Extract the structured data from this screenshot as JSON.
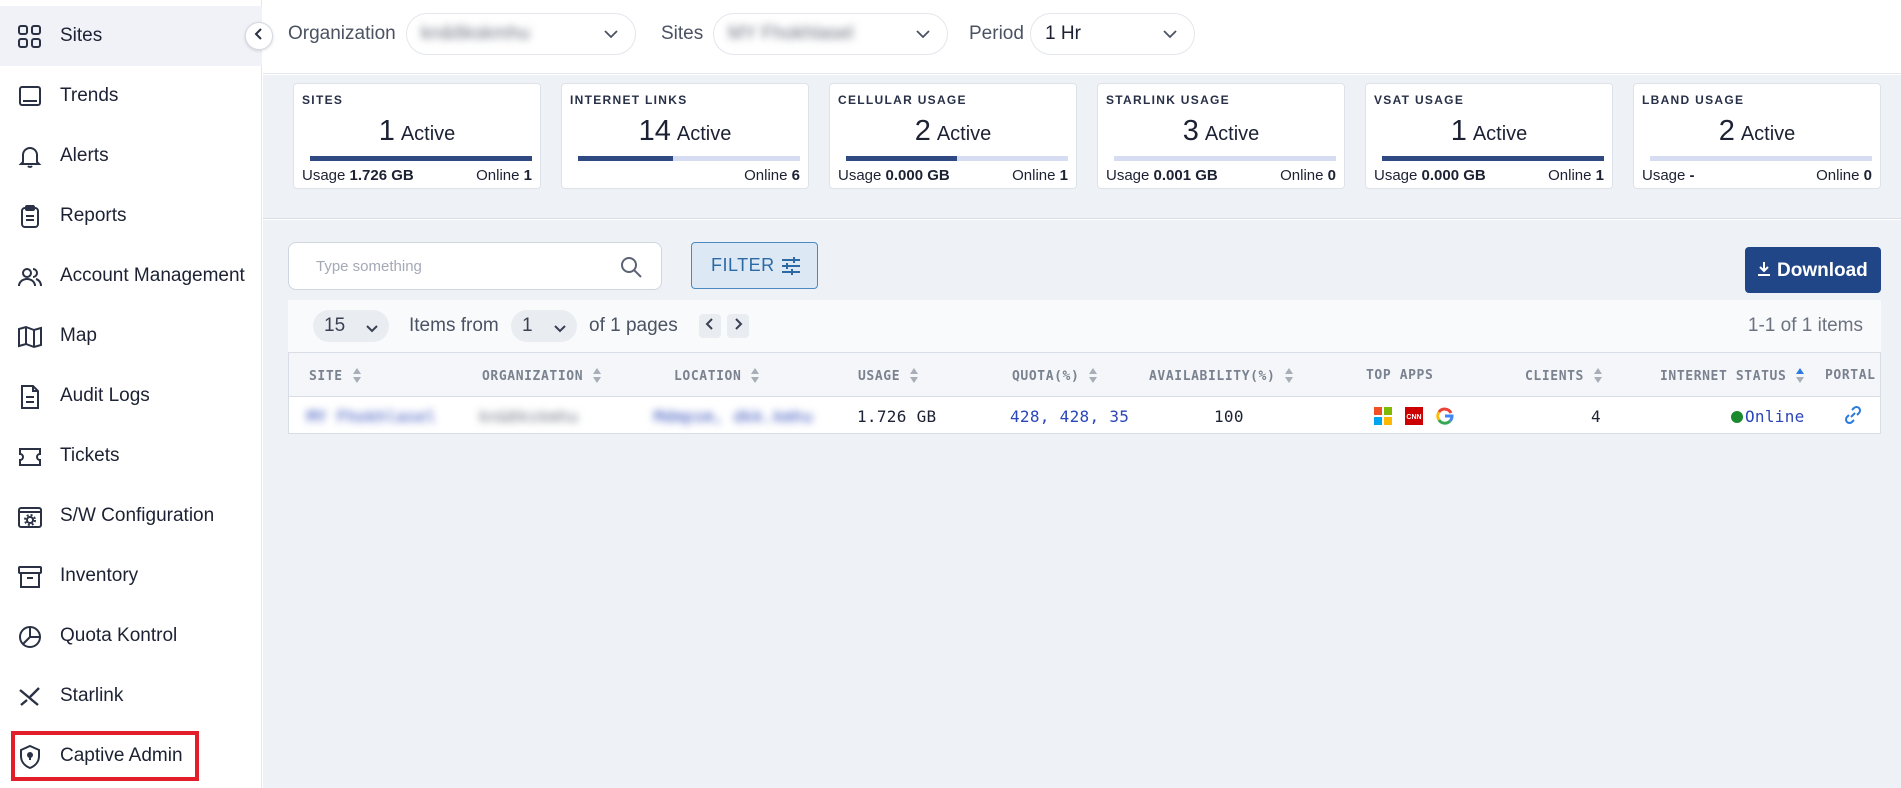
{
  "sidebar": {
    "collapse_icon": "chevron-left-icon",
    "items": [
      {
        "label": "Sites",
        "icon": "grid-icon"
      },
      {
        "label": "Trends",
        "icon": "monitor-icon"
      },
      {
        "label": "Alerts",
        "icon": "bell-icon"
      },
      {
        "label": "Reports",
        "icon": "clipboard-icon"
      },
      {
        "label": "Account Management",
        "icon": "users-icon"
      },
      {
        "label": "Map",
        "icon": "map-icon"
      },
      {
        "label": "Audit Logs",
        "icon": "document-icon"
      },
      {
        "label": "Tickets",
        "icon": "ticket-icon"
      },
      {
        "label": "S/W Configuration",
        "icon": "config-gear-icon"
      },
      {
        "label": "Inventory",
        "icon": "archive-icon"
      },
      {
        "label": "Quota Kontrol",
        "icon": "pie-chart-icon"
      },
      {
        "label": "Starlink",
        "icon": "starlink-x-icon"
      },
      {
        "label": "Captive Admin",
        "icon": "shield-icon"
      }
    ],
    "active": "Sites",
    "highlighted": "Captive Admin",
    "highlight_color": "#e21e2b"
  },
  "filters": {
    "organization": {
      "label": "Organization",
      "value": "kn&6kskmhu"
    },
    "sites": {
      "label": "Sites",
      "value": "MY Fhokhlasel"
    },
    "period": {
      "label": "Period",
      "value": "1 Hr"
    }
  },
  "cards": [
    {
      "title": "SITES",
      "count": "1",
      "unit": "Active",
      "progress": 1.0,
      "left_label": "Usage",
      "left_value": "1.726 GB",
      "right_label": "Online",
      "right_value": "1"
    },
    {
      "title": "INTERNET LINKS",
      "count": "14",
      "unit": "Active",
      "progress": 0.43,
      "left_label": "",
      "left_value": "",
      "right_label": "Online",
      "right_value": "6"
    },
    {
      "title": "CELLULAR USAGE",
      "count": "2",
      "unit": "Active",
      "progress": 0.5,
      "left_label": "Usage",
      "left_value": "0.000 GB",
      "right_label": "Online",
      "right_value": "1"
    },
    {
      "title": "STARLINK USAGE",
      "count": "3",
      "unit": "Active",
      "progress": 0.0,
      "left_label": "Usage",
      "left_value": "0.001 GB",
      "right_label": "Online",
      "right_value": "0"
    },
    {
      "title": "VSAT USAGE",
      "count": "1",
      "unit": "Active",
      "progress": 1.0,
      "left_label": "Usage",
      "left_value": "0.000 GB",
      "right_label": "Online",
      "right_value": "1"
    },
    {
      "title": "LBAND USAGE",
      "count": "2",
      "unit": "Active",
      "progress": 0.0,
      "left_label": "Usage",
      "left_value": "-",
      "right_label": "Online",
      "right_value": "0"
    }
  ],
  "colors": {
    "accent": "#204687",
    "bar_fill": "#2f4a83",
    "bar_track": "#d6dcf2",
    "link": "#2a46b8",
    "online": "#1b8a2e"
  },
  "search": {
    "placeholder": "Type something",
    "icon": "search-icon"
  },
  "filter_button": {
    "label": "FILTER",
    "icon": "sliders-icon"
  },
  "download_button": {
    "label": "Download",
    "icon": "download-icon"
  },
  "pagination": {
    "page_size": "15",
    "items_from_label": "Items from",
    "page": "1",
    "of_pages_label": "of 1 pages",
    "range": "1-1 of 1 items"
  },
  "table": {
    "columns": [
      {
        "label": "SITE",
        "sortable": true
      },
      {
        "label": "ORGANIZATION",
        "sortable": true
      },
      {
        "label": "LOCATION",
        "sortable": true
      },
      {
        "label": "USAGE",
        "sortable": true
      },
      {
        "label": "QUOTA(%)",
        "sortable": true
      },
      {
        "label": "AVAILABILITY(%)",
        "sortable": true
      },
      {
        "label": "TOP APPS",
        "sortable": false
      },
      {
        "label": "CLIENTS",
        "sortable": true
      },
      {
        "label": "INTERNET STATUS",
        "sortable": true,
        "sorted": "asc"
      },
      {
        "label": "PORTAL",
        "sortable": false
      }
    ],
    "rows": [
      {
        "site": "MY Fhokhlasel",
        "organization": "kn&6kskmhu",
        "location": "Mdmpsm, dkk.kmhu",
        "usage": "1.726 GB",
        "quota": "428, 428, 35",
        "availability": "100",
        "top_apps": [
          "microsoft-icon",
          "cnn-icon",
          "google-icon"
        ],
        "clients": "4",
        "internet_status": "Online",
        "portal_icon": "link-icon"
      }
    ]
  }
}
